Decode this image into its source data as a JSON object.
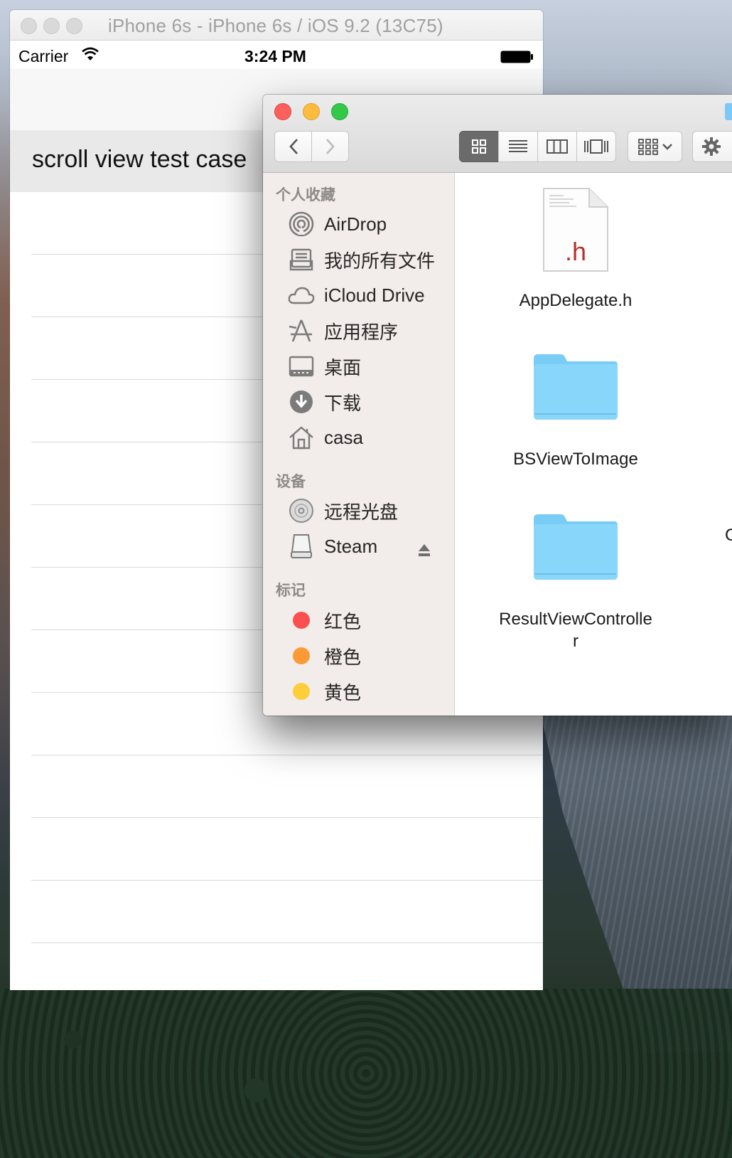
{
  "simulator": {
    "title": "iPhone 6s - iPhone 6s / iOS 9.2 (13C75)",
    "status": {
      "carrier": "Carrier",
      "time": "3:24 PM"
    },
    "section_title": "scroll view test case",
    "row_count": 12
  },
  "finder": {
    "sidebar": {
      "favorites_heading": "个人收藏",
      "favorites": [
        {
          "label": "AirDrop",
          "icon": "airdrop-icon"
        },
        {
          "label": "我的所有文件",
          "icon": "all-files-icon"
        },
        {
          "label": "iCloud Drive",
          "icon": "icloud-icon"
        },
        {
          "label": "应用程序",
          "icon": "applications-icon"
        },
        {
          "label": "桌面",
          "icon": "desktop-icon"
        },
        {
          "label": "下载",
          "icon": "downloads-icon"
        },
        {
          "label": "casa",
          "icon": "home-icon"
        }
      ],
      "devices_heading": "设备",
      "devices": [
        {
          "label": "远程光盘",
          "icon": "remote-disc-icon"
        },
        {
          "label": "Steam",
          "icon": "drive-icon"
        }
      ],
      "tags_heading": "标记",
      "tags": [
        {
          "label": "红色",
          "color": "#fc4f4f"
        },
        {
          "label": "橙色",
          "color": "#fd9a36"
        },
        {
          "label": "黄色",
          "color": "#fdce3c"
        }
      ]
    },
    "files": [
      {
        "name": "AppDelegate.h",
        "type": "header-file",
        "ext": ".h"
      },
      {
        "name": "BSViewToImage",
        "type": "folder"
      },
      {
        "name": "ResultViewControlle",
        "name2": "r",
        "type": "folder"
      },
      {
        "name": "C",
        "type": "partial"
      }
    ]
  }
}
